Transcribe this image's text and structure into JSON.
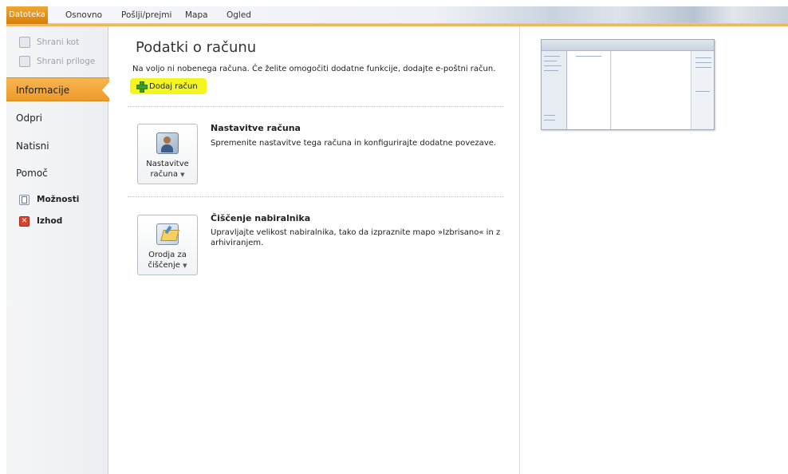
{
  "ribbon": {
    "tabs": [
      "Datoteka",
      "Osnovno",
      "Pošlji/prejmi",
      "Mapa",
      "Ogled"
    ]
  },
  "sidebar": {
    "small_items": [
      "Shrani kot",
      "Shrani priloge"
    ],
    "items": [
      "Informacije",
      "Odpri",
      "Natisni",
      "Pomoč"
    ],
    "icon_items": [
      "Možnosti",
      "Izhod"
    ],
    "active_index": 0
  },
  "main": {
    "title": "Podatki o računu",
    "subtitle": "Na voljo ni nobenega računa. Če želite omogočiti dodatne funkcije, dodajte e-poštni račun.",
    "add_account_label": "Dodaj račun",
    "sections": [
      {
        "button_label": "Nastavitve računa",
        "heading": "Nastavitve računa",
        "description": "Spremenite nastavitve tega računa in konfigurirajte dodatne povezave."
      },
      {
        "button_label": "Orodja za čiščenje",
        "heading": "Čiščenje nabiralnika",
        "description": "Upravljajte velikost nabiralnika, tako da izpraznite mapo »Izbrisano« in z arhiviranjem."
      }
    ]
  },
  "colors": {
    "file_tab": "#e38a12",
    "active_nav": "#f2a83c",
    "highlight": "#f4f51f"
  }
}
